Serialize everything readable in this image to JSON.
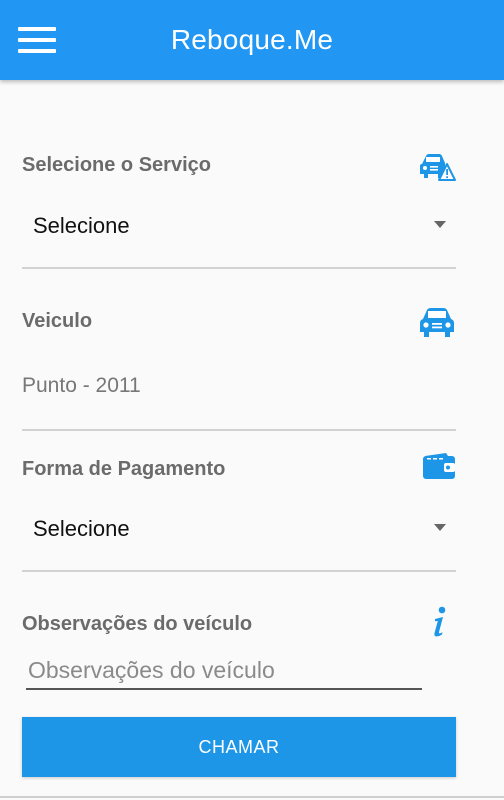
{
  "app": {
    "title": "Reboque.Me",
    "accent_color": "#2196f3",
    "menu_icon": "menu-icon"
  },
  "servico": {
    "label": "Selecione o Serviço",
    "icon": "car-warning-icon",
    "selected": "Selecione"
  },
  "veiculo": {
    "label": "Veiculo",
    "icon": "car-icon",
    "value": "Punto - 2011"
  },
  "pagamento": {
    "label": "Forma de Pagamento",
    "icon": "wallet-icon",
    "selected": "Selecione"
  },
  "observacoes": {
    "label": "Observações do veículo",
    "icon": "info-icon",
    "placeholder": "Observações do veículo"
  },
  "actions": {
    "submit_label": "CHAMAR"
  }
}
